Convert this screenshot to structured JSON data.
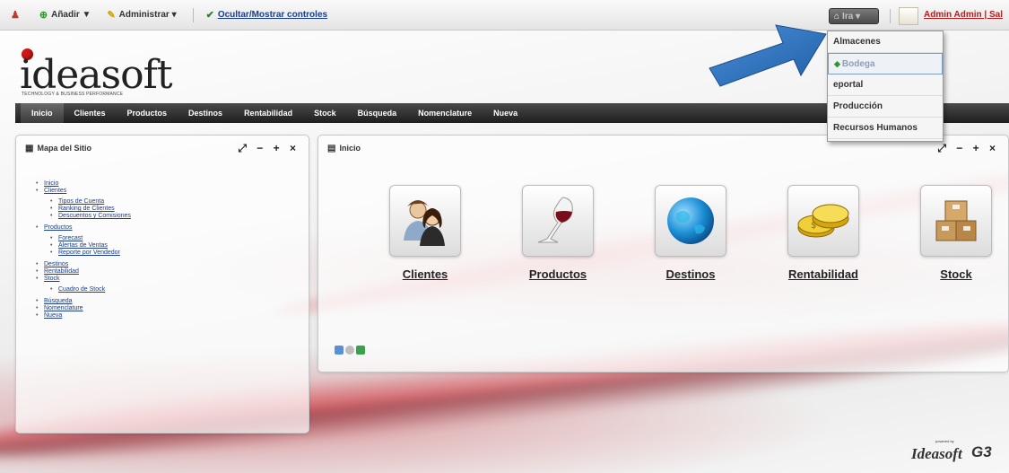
{
  "toolbar": {
    "add_label": "Añadir ▼",
    "admin_label": "Administrar ▾",
    "toggle_label": "Ocultar/Mostrar controles",
    "home_label": "Ira ▾",
    "user_label": "Admin Admin | Sal"
  },
  "dropdown": {
    "items": [
      "Almacenes",
      "Bodega",
      "eportal",
      "Producción",
      "Recursos Humanos"
    ]
  },
  "logo": {
    "name": "ideasoft",
    "tagline": "TECHNOLOGY & BUSINESS PERFORMANCE"
  },
  "nav": {
    "items": [
      "Inicio",
      "Clientes",
      "Productos",
      "Destinos",
      "Rentabilidad",
      "Stock",
      "Búsqueda",
      "Nomenclature",
      "Nueva"
    ]
  },
  "sitemap": {
    "title": "Mapa del Sitio",
    "tools": "⤢ − + ×",
    "items": {
      "inicio": "Inicio",
      "clientes": "Clientes",
      "clientes_sub": [
        "Tipos de Cuenta",
        "Ranking de Clientes",
        "Descuentos y Comisiones"
      ],
      "productos": "Productos",
      "productos_sub": [
        "Forecast",
        "Alertas de Ventas",
        "Reporte por Vendedor"
      ],
      "destinos": "Destinos",
      "rentabilidad": "Rentabilidad",
      "stock": "Stock",
      "stock_sub": [
        "Cuadro de Stock"
      ],
      "busqueda": "Búsqueda",
      "nomenclature": "Nomenclature",
      "nueva": "Nueva"
    }
  },
  "main": {
    "title": "Inicio",
    "tools": "⤢ − + ×",
    "tiles": [
      {
        "label": "Clientes",
        "icon": "users-icon"
      },
      {
        "label": "Productos",
        "icon": "wine-glass-icon"
      },
      {
        "label": "Destinos",
        "icon": "globe-icon"
      },
      {
        "label": "Rentabilidad",
        "icon": "coins-icon"
      },
      {
        "label": "Stock",
        "icon": "boxes-icon"
      }
    ]
  },
  "footer": {
    "powered_small": "powered by",
    "brand": "Ideasoft"
  },
  "colors": {
    "nav_bg": "#2a2a2a",
    "link": "#1a3e8c",
    "user_link": "#b02020",
    "accent_red": "#d01818",
    "arrow_blue": "#2f6fb8"
  }
}
